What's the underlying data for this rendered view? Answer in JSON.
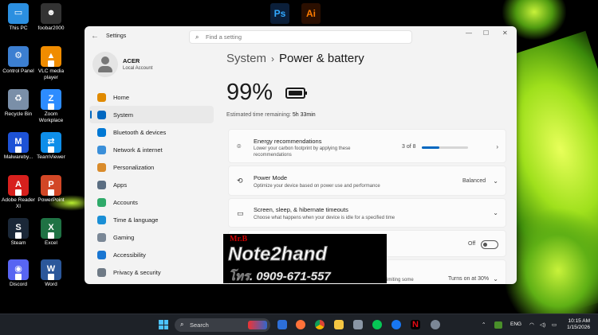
{
  "desktop": {
    "icons": [
      {
        "label": "This PC",
        "icon": "monitor-icon",
        "color": "#2b8fe0"
      },
      {
        "label": "foobar2000",
        "icon": "foobar-icon",
        "color": "#333333"
      },
      {
        "label": "Control Panel",
        "icon": "control-panel-icon",
        "color": "#3c7fd1"
      },
      {
        "label": "VLC media player",
        "icon": "vlc-cone-icon",
        "color": "#f08c00"
      },
      {
        "label": "Recycle Bin",
        "icon": "recycle-bin-icon",
        "color": "#7a8fa8"
      },
      {
        "label": "Zoom Workplace",
        "icon": "zoom-icon",
        "color": "#2d8cff"
      },
      {
        "label": "Malwareby...",
        "icon": "malwarebytes-icon",
        "color": "#1d52d6"
      },
      {
        "label": "TeamViewer",
        "icon": "teamviewer-icon",
        "color": "#0e8ee9"
      },
      {
        "label": "Adobe Reader XI",
        "icon": "adobe-reader-icon",
        "color": "#d7201d"
      },
      {
        "label": "PowerPoint",
        "icon": "powerpoint-icon",
        "color": "#d24726"
      },
      {
        "label": "Steam",
        "icon": "steam-icon",
        "color": "#1b2838"
      },
      {
        "label": "Excel",
        "icon": "excel-icon",
        "color": "#1f7244"
      },
      {
        "label": "Discord",
        "icon": "discord-icon",
        "color": "#5865f2"
      },
      {
        "label": "Word",
        "icon": "word-icon",
        "color": "#2b579a"
      }
    ],
    "top_apps": [
      {
        "label": "Ps",
        "icon": "photoshop-icon",
        "bg": "#0b1f3a",
        "fg": "#31a8ff"
      },
      {
        "label": "Ai",
        "icon": "illustrator-icon",
        "bg": "#2b0f00",
        "fg": "#ff7c00"
      }
    ]
  },
  "window": {
    "app_title": "Settings",
    "search_placeholder": "Find a setting",
    "profile": {
      "name": "ACER",
      "subtitle": "Local Account"
    },
    "nav": [
      {
        "label": "Home",
        "icon": "home-icon",
        "color": "#e08a00",
        "active": false
      },
      {
        "label": "System",
        "icon": "system-icon",
        "color": "#0067c0",
        "active": true
      },
      {
        "label": "Bluetooth & devices",
        "icon": "bluetooth-icon",
        "color": "#0078d4",
        "active": false
      },
      {
        "label": "Network & internet",
        "icon": "network-icon",
        "color": "#3a8fd9",
        "active": false
      },
      {
        "label": "Personalization",
        "icon": "brush-icon",
        "color": "#d98b2b",
        "active": false
      },
      {
        "label": "Apps",
        "icon": "apps-icon",
        "color": "#5b6e82",
        "active": false
      },
      {
        "label": "Accounts",
        "icon": "accounts-icon",
        "color": "#2faa6a",
        "active": false
      },
      {
        "label": "Time & language",
        "icon": "time-language-icon",
        "color": "#1a8fd6",
        "active": false
      },
      {
        "label": "Gaming",
        "icon": "gaming-icon",
        "color": "#7a8796",
        "active": false
      },
      {
        "label": "Accessibility",
        "icon": "accessibility-icon",
        "color": "#1976d2",
        "active": false
      },
      {
        "label": "Privacy & security",
        "icon": "shield-icon",
        "color": "#6f7a86",
        "active": false
      }
    ],
    "breadcrumb": {
      "parent": "System",
      "separator": "›",
      "current": "Power & battery"
    },
    "battery": {
      "percent_label": "99%",
      "level": 0.99
    },
    "estimate": {
      "label": "Estimated time remaining:",
      "value": "5h 33min"
    },
    "cards": {
      "energy": {
        "title": "Energy recommendations",
        "desc1": "Lower your carbon footprint by applying these",
        "desc2": "recommendations",
        "value": "3 of 8",
        "progress": 0.375
      },
      "power_mode": {
        "title": "Power Mode",
        "desc": "Optimize your device based on power use and performance",
        "value": "Balanced"
      },
      "sleep": {
        "title": "Screen, sleep, & hibernate timeouts",
        "desc": "Choose what happens when your device is idle for a specified time"
      },
      "toggle_row": {
        "value": "Off"
      },
      "saver": {
        "desc": "imiting some",
        "value": "Turns on at 30%"
      }
    }
  },
  "watermark": {
    "line1": "Mr.B",
    "line2": "Note2hand",
    "line3": "โทร. 0909-671-557"
  },
  "taskbar": {
    "search_label": "Search",
    "lang": "ENG",
    "time": "10:15 AM",
    "date": "1/15/2026"
  }
}
